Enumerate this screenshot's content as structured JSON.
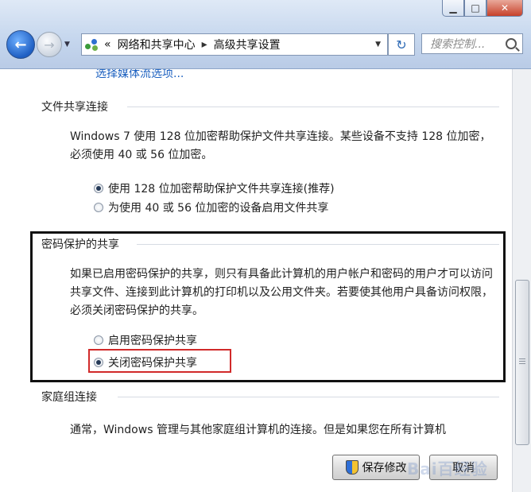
{
  "window": {
    "nav": {
      "back_icon": "back-arrow-icon",
      "forward_icon": "forward-arrow-icon"
    },
    "breadcrumb": {
      "prefix": "«",
      "items": [
        "网络和共享中心",
        "高级共享设置"
      ]
    },
    "search": {
      "placeholder": "搜索控制..."
    }
  },
  "top_link": "选择媒体流选项...",
  "file_sharing": {
    "title": "文件共享连接",
    "description": "Windows 7 使用 128 位加密帮助保护文件共享连接。某些设备不支持 128 位加密，必须使用 40 或 56 位加密。",
    "options": [
      {
        "label": "使用 128 位加密帮助保护文件共享连接(推荐)",
        "selected": true
      },
      {
        "label": "为使用 40 或 56 位加密的设备启用文件共享",
        "selected": false
      }
    ]
  },
  "password_sharing": {
    "title": "密码保护的共享",
    "description": "如果已启用密码保护的共享，则只有具备此计算机的用户帐户和密码的用户才可以访问共享文件、连接到此计算机的打印机以及公用文件夹。若要使其他用户具备访问权限，必须关闭密码保护的共享。",
    "options": [
      {
        "label": "启用密码保护共享",
        "selected": false
      },
      {
        "label": "关闭密码保护共享",
        "selected": true
      }
    ]
  },
  "homegroup": {
    "title": "家庭组连接",
    "description": "通常，Windows 管理与其他家庭组计算机的连接。但是如果您在所有计算机"
  },
  "buttons": {
    "save": "保存修改",
    "cancel": "取消"
  },
  "colors": {
    "highlight_box": "#111111",
    "selected_option_box": "#d12a2a",
    "link": "#1a5fbf"
  },
  "watermark": "Bai百经验"
}
